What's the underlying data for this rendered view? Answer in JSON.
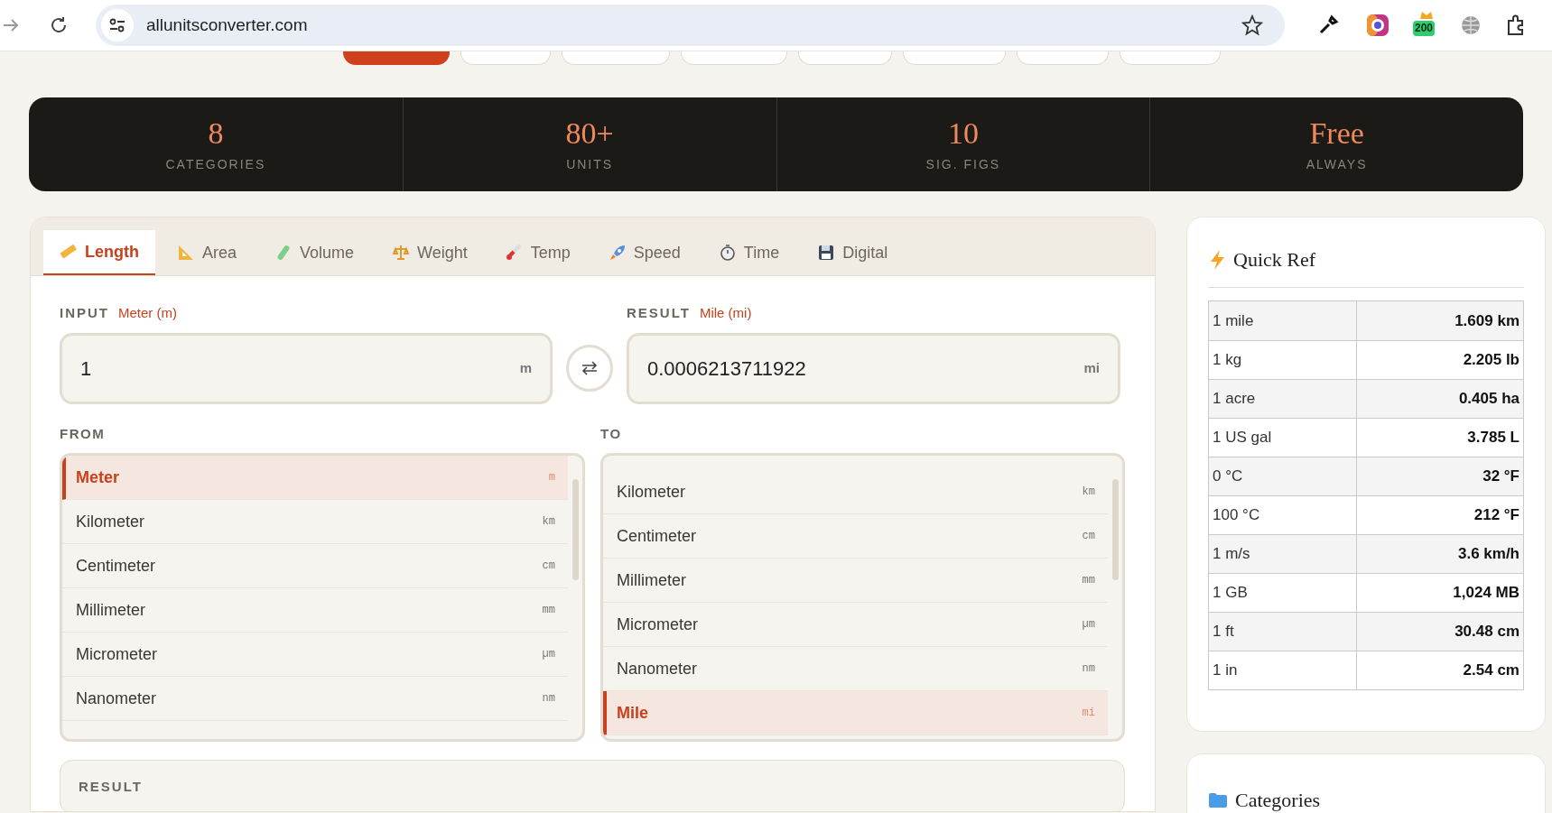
{
  "browser": {
    "url": "allunitsconverter.com",
    "badge": "200"
  },
  "nav_pills": [
    {
      "selected": true
    },
    {
      "selected": false
    },
    {
      "selected": false
    },
    {
      "selected": false
    },
    {
      "selected": false
    },
    {
      "selected": false
    },
    {
      "selected": false
    },
    {
      "selected": false
    }
  ],
  "stats": [
    {
      "value": "8",
      "label": "CATEGORIES"
    },
    {
      "value": "80+",
      "label": "UNITS"
    },
    {
      "value": "10",
      "label": "SIG. FIGS"
    },
    {
      "value": "Free",
      "label": "ALWAYS"
    }
  ],
  "tabs": [
    {
      "kind": "ruler",
      "label": "Length",
      "selected": true
    },
    {
      "kind": "triangle",
      "label": "Area",
      "selected": false
    },
    {
      "kind": "tube",
      "label": "Volume",
      "selected": false
    },
    {
      "kind": "scale",
      "label": "Weight",
      "selected": false
    },
    {
      "kind": "thermometer",
      "label": "Temp",
      "selected": false
    },
    {
      "kind": "rocket",
      "label": "Speed",
      "selected": false
    },
    {
      "kind": "stopwatch",
      "label": "Time",
      "selected": false
    },
    {
      "kind": "floppy",
      "label": "Digital",
      "selected": false
    }
  ],
  "input": {
    "label": "INPUT",
    "unit": "Meter (m)",
    "value": "1",
    "symbol": "m"
  },
  "result": {
    "label": "RESULT",
    "unit": "Mile (mi)",
    "value": "0.0006213711922",
    "symbol": "mi"
  },
  "from": {
    "label": "FROM",
    "items": [
      {
        "name": "Meter",
        "symbol": "m",
        "selected": true
      },
      {
        "name": "Kilometer",
        "symbol": "km",
        "selected": false
      },
      {
        "name": "Centimeter",
        "symbol": "cm",
        "selected": false
      },
      {
        "name": "Millimeter",
        "symbol": "mm",
        "selected": false
      },
      {
        "name": "Micrometer",
        "symbol": "µm",
        "selected": false
      },
      {
        "name": "Nanometer",
        "symbol": "nm",
        "selected": false
      }
    ]
  },
  "to": {
    "label": "TO",
    "items": [
      {
        "name": "Kilometer",
        "symbol": "km",
        "selected": false
      },
      {
        "name": "Centimeter",
        "symbol": "cm",
        "selected": false
      },
      {
        "name": "Millimeter",
        "symbol": "mm",
        "selected": false
      },
      {
        "name": "Micrometer",
        "symbol": "µm",
        "selected": false
      },
      {
        "name": "Nanometer",
        "symbol": "nm",
        "selected": false
      },
      {
        "name": "Mile",
        "symbol": "mi",
        "selected": true
      }
    ]
  },
  "result_panel": {
    "label": "RESULT"
  },
  "quick_ref": {
    "title": "Quick Ref",
    "rows": [
      {
        "from": "1 mile",
        "to": "1.609 km"
      },
      {
        "from": "1 kg",
        "to": "2.205 lb"
      },
      {
        "from": "1 acre",
        "to": "0.405 ha"
      },
      {
        "from": "1 US gal",
        "to": "3.785 L"
      },
      {
        "from": "0 °C",
        "to": "32 °F"
      },
      {
        "from": "100 °C",
        "to": "212 °F"
      },
      {
        "from": "1 m/s",
        "to": "3.6 km/h"
      },
      {
        "from": "1 GB",
        "to": "1,024 MB"
      },
      {
        "from": "1 ft",
        "to": "30.48 cm"
      },
      {
        "from": "1 in",
        "to": "2.54 cm"
      }
    ]
  },
  "categories": {
    "title": "Categories"
  }
}
